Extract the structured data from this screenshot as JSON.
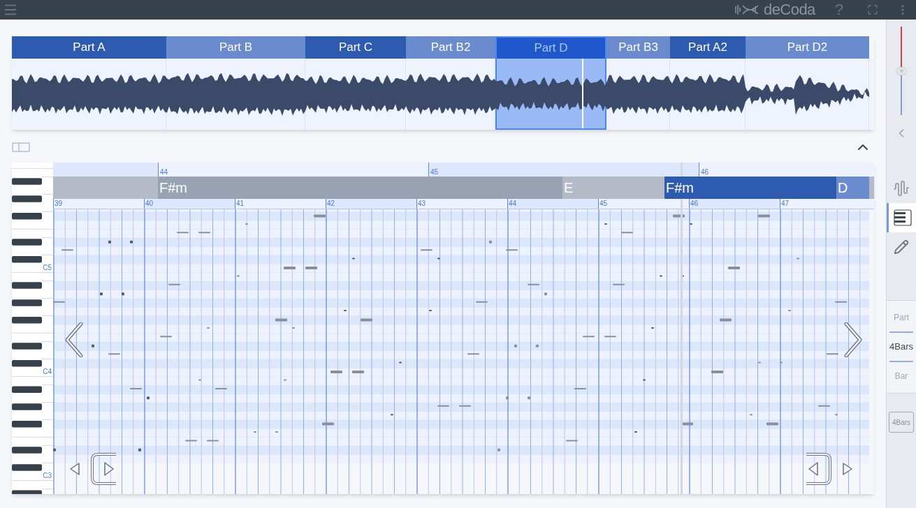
{
  "header": {
    "brand": "deCoda",
    "help": "?"
  },
  "parts": [
    {
      "label": "Part A",
      "selected": false,
      "color": "#2d5bb0"
    },
    {
      "label": "Part B",
      "selected": false,
      "color": "#6a8ccf"
    },
    {
      "label": "Part C",
      "selected": false,
      "color": "#2d5bb0"
    },
    {
      "label": "Part B2",
      "selected": false,
      "color": "#6a8ccf"
    },
    {
      "label": "Part D",
      "selected": true,
      "color": "#2058cc"
    },
    {
      "label": "Part B3",
      "selected": false,
      "color": "#6a8ccf"
    },
    {
      "label": "Part A2",
      "selected": false,
      "color": "#2d5bb0"
    },
    {
      "label": "Part D2",
      "selected": false,
      "color": "#6a8ccf"
    }
  ],
  "piano_roll": {
    "ruler": [
      "44",
      "45",
      "46"
    ],
    "chords": [
      {
        "label": "F#m",
        "color": "#98a2b2"
      },
      {
        "label": "E",
        "color": "#b4bac6"
      },
      {
        "label": "F#m",
        "color": "#2d5bb0"
      },
      {
        "label": "D",
        "color": "#6a8ccf"
      }
    ],
    "bars": [
      "39",
      "40",
      "41",
      "42",
      "43",
      "44",
      "45",
      "46",
      "47"
    ],
    "key_labels": [
      "C5",
      "C4",
      "C3"
    ]
  },
  "sidebar": {
    "volume": {
      "level": 0.5
    },
    "tools": [
      {
        "kind": "waveform",
        "selected": false
      },
      {
        "kind": "piano_roll",
        "selected": true
      },
      {
        "kind": "pencil",
        "selected": false
      }
    ],
    "zoom": [
      {
        "label": "Part",
        "selected": false
      },
      {
        "label": "4Bars",
        "selected": true
      },
      {
        "label": "Bar",
        "selected": false
      }
    ],
    "loop_length": "4Bars"
  }
}
